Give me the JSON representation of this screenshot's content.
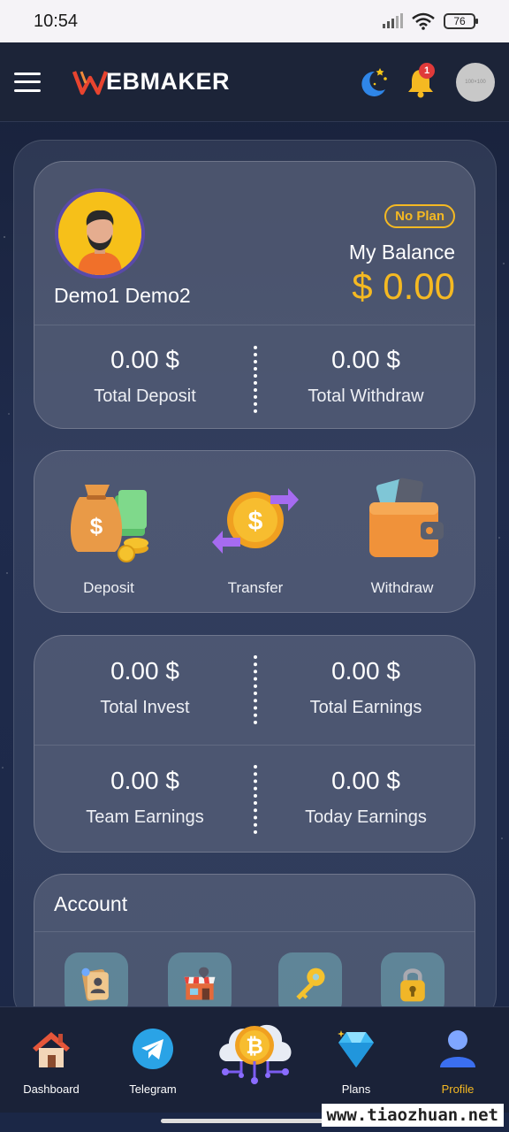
{
  "status_bar": {
    "time": "10:54",
    "battery": "76"
  },
  "header": {
    "logo_text": "EBMAKER",
    "notification_count": "1",
    "avatar_placeholder": "100×100"
  },
  "profile": {
    "name": "Demo1 Demo2",
    "plan_badge": "No Plan",
    "balance_label": "My Balance",
    "balance_value": "$ 0.00",
    "total_deposit_value": "0.00 $",
    "total_deposit_label": "Total Deposit",
    "total_withdraw_value": "0.00 $",
    "total_withdraw_label": "Total Withdraw"
  },
  "actions": [
    {
      "label": "Deposit",
      "icon": "money-bag-icon"
    },
    {
      "label": "Transfer",
      "icon": "transfer-coin-icon"
    },
    {
      "label": "Withdraw",
      "icon": "wallet-icon"
    }
  ],
  "stats": [
    {
      "value": "0.00 $",
      "label": "Total Invest"
    },
    {
      "value": "0.00 $",
      "label": "Total Earnings"
    },
    {
      "value": "0.00 $",
      "label": "Team Earnings"
    },
    {
      "value": "0.00 $",
      "label": "Today Earnings"
    }
  ],
  "account": {
    "title": "Account",
    "tiles": [
      "profile-card-icon",
      "shop-icon",
      "key-icon",
      "lock-icon"
    ]
  },
  "bottom_nav": [
    {
      "label": "Dashboard",
      "icon": "house-icon"
    },
    {
      "label": "Telegram",
      "icon": "telegram-icon"
    },
    {
      "label": "",
      "icon": "bitcoin-cloud-icon"
    },
    {
      "label": "Plans",
      "icon": "diamond-icon"
    },
    {
      "label": "Profile",
      "icon": "user-icon",
      "active": true
    }
  ],
  "watermark": "www.tiaozhuan.net",
  "colors": {
    "accent": "#f5b922",
    "badge": "#e03a3a"
  }
}
